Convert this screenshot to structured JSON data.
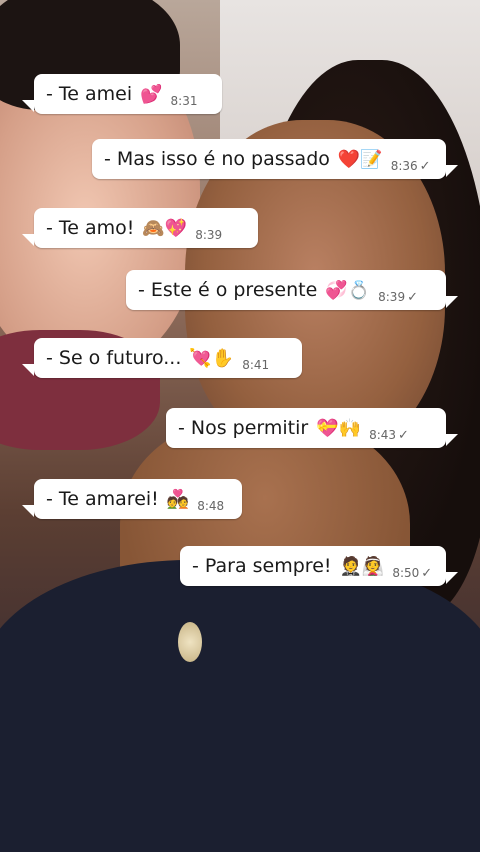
{
  "messages": [
    {
      "id": "m1",
      "text": "- Te amei",
      "emoji": "💕",
      "time": "8:31",
      "direction": "in"
    },
    {
      "id": "m2",
      "text": "- Mas isso é no passado",
      "emoji": "❤️📝",
      "time": "8:36",
      "direction": "out",
      "status": "✓"
    },
    {
      "id": "m3",
      "text": "- Te amo!",
      "emoji": "🙈💖",
      "time": "8:39",
      "direction": "in"
    },
    {
      "id": "m4",
      "text": "- Este é o presente",
      "emoji": "💞💍",
      "time": "8:39",
      "direction": "out",
      "status": "✓"
    },
    {
      "id": "m5",
      "text": "- Se o futuro...",
      "emoji": "💘✋",
      "time": "8:41",
      "direction": "in"
    },
    {
      "id": "m6",
      "text": "- Nos permitir",
      "emoji": "💝🙌",
      "time": "8:43",
      "direction": "out",
      "status": "✓"
    },
    {
      "id": "m7",
      "text": "- Te amarei!",
      "emoji": "💑",
      "time": "8:48",
      "direction": "in"
    },
    {
      "id": "m8",
      "text": "- Para sempre!",
      "emoji": "🤵👰",
      "time": "8:50",
      "direction": "out",
      "status": "✓"
    }
  ]
}
